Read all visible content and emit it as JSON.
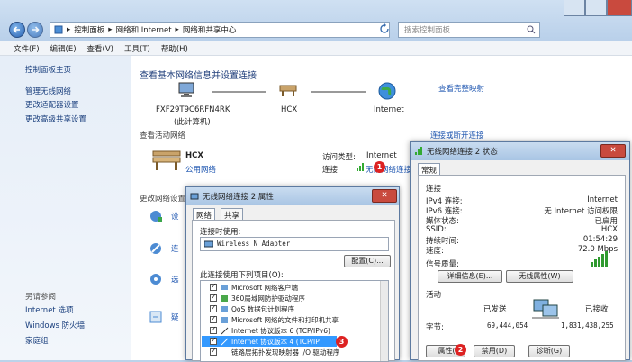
{
  "address": {
    "crumbs": [
      "控制面板",
      "网络和 Internet",
      "网络和共享中心"
    ],
    "separator": "▸",
    "search_placeholder": "搜索控制面板"
  },
  "menu": [
    "文件(F)",
    "编辑(E)",
    "查看(V)",
    "工具(T)",
    "帮助(H)"
  ],
  "sidebar": {
    "home": "控制面板主页",
    "links": [
      "管理无线网络",
      "更改适配器设置",
      "更改高级共享设置"
    ],
    "see_also_label": "另请参阅",
    "see_also": [
      "Internet 选项",
      "Windows 防火墙",
      "家庭组"
    ]
  },
  "content": {
    "heading": "查看基本网络信息并设置连接",
    "view_full_map": "查看完整映射",
    "nodes": {
      "computer": "FXF29T9C6RFN4RK",
      "computer_sub": "(此计算机)",
      "network": "HCX",
      "internet": "Internet"
    },
    "active_label": "查看活动网络",
    "connect_disconnect": "连接或断开连接",
    "network_name": "HCX",
    "network_type": "公用网络",
    "access_type_label": "访问类型:",
    "access_type_value": "Internet",
    "connections_label": "连接:",
    "connection_value": "无线网络连接",
    "change_label": "更改网络设置",
    "settings_items": [
      "设",
      "连",
      "选",
      "疑"
    ]
  },
  "status_dialog": {
    "title": "无线网络连接 2 状态",
    "tab": "常规",
    "conn_label": "连接",
    "rows": [
      {
        "k": "IPv4 连接:",
        "v": "Internet"
      },
      {
        "k": "IPv6 连接:",
        "v": "无 Internet 访问权限"
      },
      {
        "k": "媒体状态:",
        "v": "已启用"
      },
      {
        "k": "SSID:",
        "v": "HCX"
      },
      {
        "k": "持续时间:",
        "v": "01:54:29"
      },
      {
        "k": "速度:",
        "v": "72.0 Mbps"
      }
    ],
    "signal_label": "信号质量:",
    "details_btn": "详细信息(E)...",
    "wireless_btn": "无线属性(W)",
    "activity_label": "活动",
    "sent_label": "已发送",
    "recv_label": "已接收",
    "bytes_label": "字节:",
    "sent_value": "69,444,054",
    "recv_value": "1,831,438,255",
    "prop_btn": "属性(P)",
    "disable_btn": "禁用(D)",
    "diag_btn": "诊断(G)",
    "badge1": "1",
    "badge2": "2"
  },
  "props_dialog": {
    "title": "无线网络连接 2 属性",
    "tabs": [
      "网络",
      "共享"
    ],
    "connect_using": "连接时使用:",
    "adapter": "Wireless N Adapter",
    "configure_btn": "配置(C)...",
    "items_label": "此连接使用下列项目(O):",
    "items": [
      "Microsoft 网络客户端",
      "360局域网防护驱动程序",
      "QoS 数据包计划程序",
      "Microsoft 网络的文件和打印机共享",
      "Internet 协议版本 6 (TCP/IPv6)",
      "Internet 协议版本 4 (TCP/IP",
      "链路层拓扑发现映射器 I/O 驱动程序"
    ],
    "badge3": "3"
  }
}
